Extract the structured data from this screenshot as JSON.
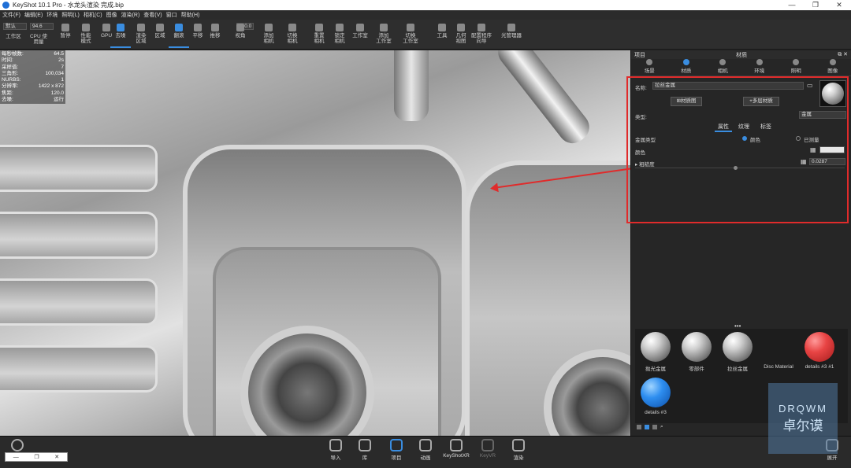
{
  "window": {
    "title": "KeyShot 10.1 Pro  - 水龙头渲染 完成.bip",
    "controls": [
      "—",
      "❐",
      "✕"
    ]
  },
  "menu": [
    "文件(F)",
    "编辑(E)",
    "环境",
    "照明(L)",
    "相机(C)",
    "图像",
    "渲染(R)",
    "查看(V)",
    "窗口",
    "帮助(H)"
  ],
  "toolbar": {
    "preset_value": "默认",
    "zoom_value": "94.6",
    "fov_value": "120.0",
    "items": [
      {
        "label": "工作区",
        "icon": "workspace-icon"
      },
      {
        "label": "CPU 使用量",
        "icon": "cpu-icon"
      },
      {
        "label": "暂停",
        "icon": "pause-icon"
      },
      {
        "label": "性能\n模式",
        "icon": "performance-icon"
      },
      {
        "label": "GPU",
        "icon": "gpu-icon"
      },
      {
        "label": "去噪",
        "icon": "denoise-icon"
      },
      {
        "label": "渲染\n区域",
        "icon": "render-region-icon"
      },
      {
        "label": "区域",
        "icon": "region-icon"
      },
      {
        "label": "翻滚",
        "icon": "tumble-icon"
      },
      {
        "label": "平移",
        "icon": "pan-icon"
      },
      {
        "label": "推移",
        "icon": "dolly-icon"
      },
      {
        "label": "视角",
        "icon": "view-icon"
      },
      {
        "label": "添加\n相机",
        "icon": "add-camera-icon"
      },
      {
        "label": "切换\n相机",
        "icon": "switch-camera-icon"
      },
      {
        "label": "重置\n相机",
        "icon": "reset-camera-icon"
      },
      {
        "label": "锁定\n相机",
        "icon": "lock-camera-icon"
      },
      {
        "label": "工作室",
        "icon": "studio-icon"
      },
      {
        "label": "添加\n工作室",
        "icon": "add-studio-icon"
      },
      {
        "label": "切换\n工作室",
        "icon": "switch-studio-icon"
      },
      {
        "label": "工具",
        "icon": "tools-icon"
      },
      {
        "label": "几何\n视图",
        "icon": "geometry-view-icon"
      },
      {
        "label": "配置程序\n向导",
        "icon": "configurator-icon"
      },
      {
        "label": "光管理器",
        "icon": "light-manager-icon"
      }
    ]
  },
  "stats": [
    {
      "k": "每秒帧数:",
      "v": "64.5"
    },
    {
      "k": "时间:",
      "v": "2s"
    },
    {
      "k": "采样值:",
      "v": "7"
    },
    {
      "k": "三角形:",
      "v": "100,034"
    },
    {
      "k": "NURBS:",
      "v": "1"
    },
    {
      "k": "分辨率:",
      "v": "1422 x 872"
    },
    {
      "k": "焦距:",
      "v": "120.0"
    },
    {
      "k": "去噪:",
      "v": "运行"
    }
  ],
  "panel": {
    "left_title": "项目",
    "title": "材质",
    "tabs": [
      {
        "label": "场景",
        "icon": "scene-icon"
      },
      {
        "label": "材质",
        "icon": "material-icon"
      },
      {
        "label": "相机",
        "icon": "camera-icon"
      },
      {
        "label": "环境",
        "icon": "environment-icon"
      },
      {
        "label": "照明",
        "icon": "lighting-icon"
      },
      {
        "label": "图像",
        "icon": "image-icon"
      }
    ],
    "name_label": "名称:",
    "name_value": "拉丝金属",
    "btn_material_graph": "材质图",
    "btn_multi_layer": "多层材质",
    "type_label": "类型:",
    "type_value": "金属",
    "subtabs": [
      "属性",
      "纹理",
      "标签"
    ],
    "metal_type_label": "金属类型",
    "opt_color": "颜色",
    "opt_measured": "已测量",
    "color_label": "颜色",
    "roughness_label": "▸ 粗糙度",
    "roughness_value": "0.0287"
  },
  "library": [
    {
      "name": "抛光金属",
      "kind": "silver"
    },
    {
      "name": "零部件",
      "kind": "silver"
    },
    {
      "name": "拉丝金属",
      "kind": "silver"
    },
    {
      "name": "Disc Material",
      "kind": "none"
    },
    {
      "name": "details #3 #1",
      "kind": "red"
    },
    {
      "name": "details #3",
      "kind": "blue"
    }
  ],
  "bottombar": [
    {
      "label": "导入",
      "icon": "import-icon",
      "state": "normal"
    },
    {
      "label": "库",
      "icon": "library-icon",
      "state": "normal"
    },
    {
      "label": "项目",
      "icon": "project-icon",
      "state": "active"
    },
    {
      "label": "动画",
      "icon": "animation-icon",
      "state": "normal"
    },
    {
      "label": "KeyShotXR",
      "icon": "keyshotxr-icon",
      "state": "normal"
    },
    {
      "label": "KeyVR",
      "icon": "keyvr-icon",
      "state": "dim"
    },
    {
      "label": "渲染",
      "icon": "render-icon",
      "state": "normal"
    }
  ],
  "expert_label": "展开",
  "watermark": {
    "en": "DRQWM",
    "zh": "卓尔谟"
  }
}
